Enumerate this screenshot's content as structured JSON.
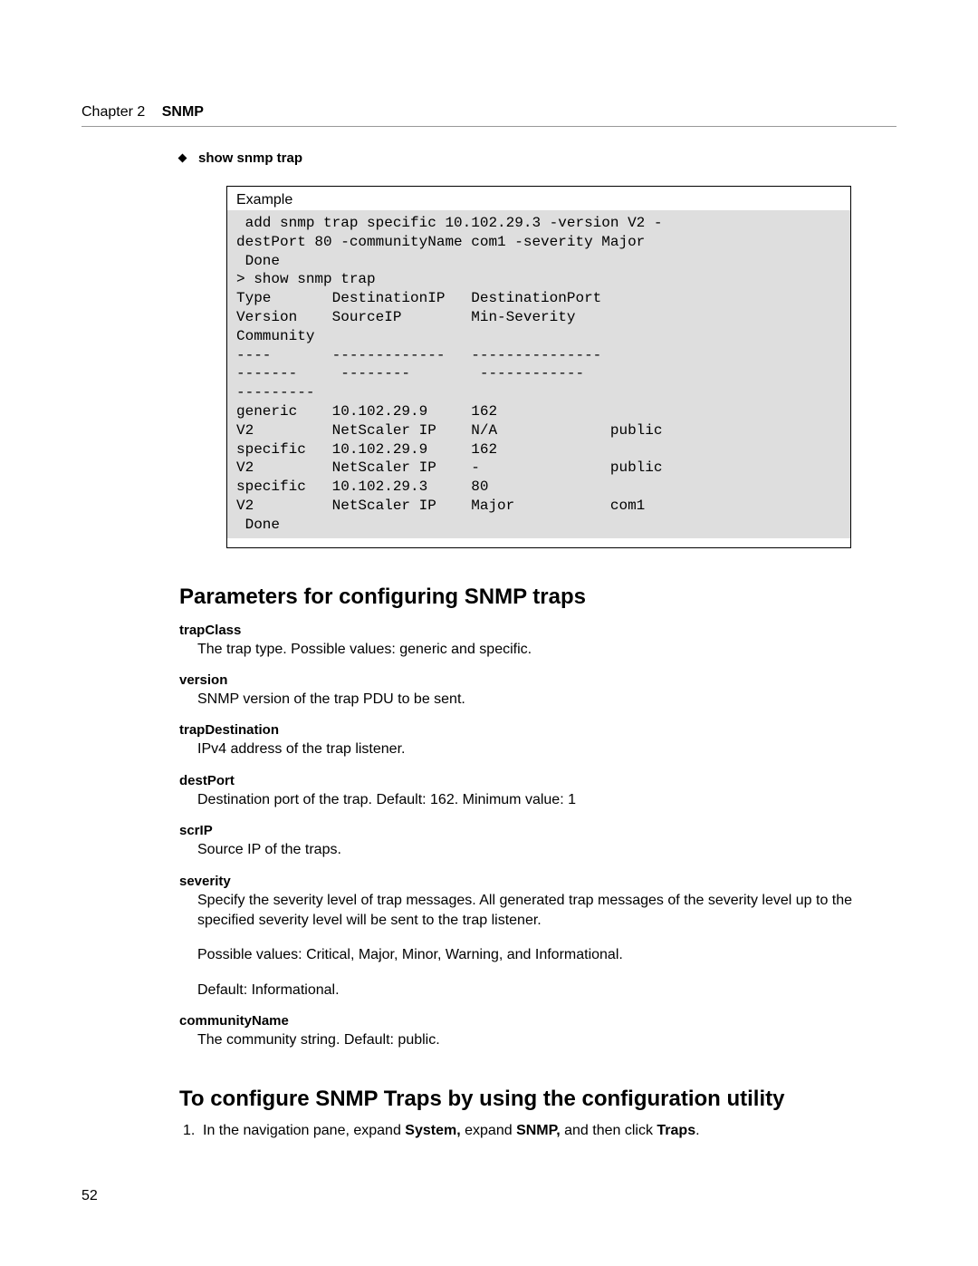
{
  "header": {
    "chapter": "Chapter 2",
    "chapter_title": "SNMP"
  },
  "bullet_label": "show snmp trap",
  "example": {
    "label": "Example",
    "code": " add snmp trap specific 10.102.29.3 -version V2 -\ndestPort 80 -communityName com1 -severity Major\n Done\n> show snmp trap\nType       DestinationIP   DestinationPort    \nVersion    SourceIP        Min-Severity    \nCommunity\n----       -------------   ---------------    \n-------     --------        ------------    \n---------\ngeneric    10.102.29.9     162                \nV2         NetScaler IP    N/A             public\nspecific   10.102.29.9     162                \nV2         NetScaler IP    -               public\nspecific   10.102.29.3     80                 \nV2         NetScaler IP    Major           com1\n Done"
  },
  "section1_title": "Parameters for configuring SNMP traps",
  "params": {
    "trapClass": {
      "name": "trapClass",
      "desc": "The trap type. Possible values: generic and specific."
    },
    "version": {
      "name": "version",
      "desc": "SNMP version of the trap PDU to be sent."
    },
    "trapDestination": {
      "name": "trapDestination",
      "desc": "IPv4 address of the trap listener."
    },
    "destPort": {
      "name": "destPort",
      "desc": "Destination port of the trap. Default: 162. Minimum value: 1"
    },
    "scrIP": {
      "name": "scrIP",
      "desc": "Source IP of the traps."
    },
    "severity": {
      "name": "severity",
      "desc1": "Specify the severity level of trap messages. All generated trap messages of the severity level up to the specified severity level will be sent to the trap listener.",
      "desc2": "Possible values: Critical, Major, Minor, Warning, and Informational.",
      "desc3": "Default: Informational."
    },
    "communityName": {
      "name": "communityName",
      "desc": "The community string. Default: public."
    }
  },
  "section2_title": "To configure SNMP Traps by using the configuration utility",
  "step1": {
    "num": "1.",
    "t1": "In the navigation pane, expand ",
    "b1": "System,",
    "t2": " expand ",
    "b2": "SNMP,",
    "t3": " and then click ",
    "b3": "Traps",
    "t4": "."
  },
  "page_number": "52"
}
